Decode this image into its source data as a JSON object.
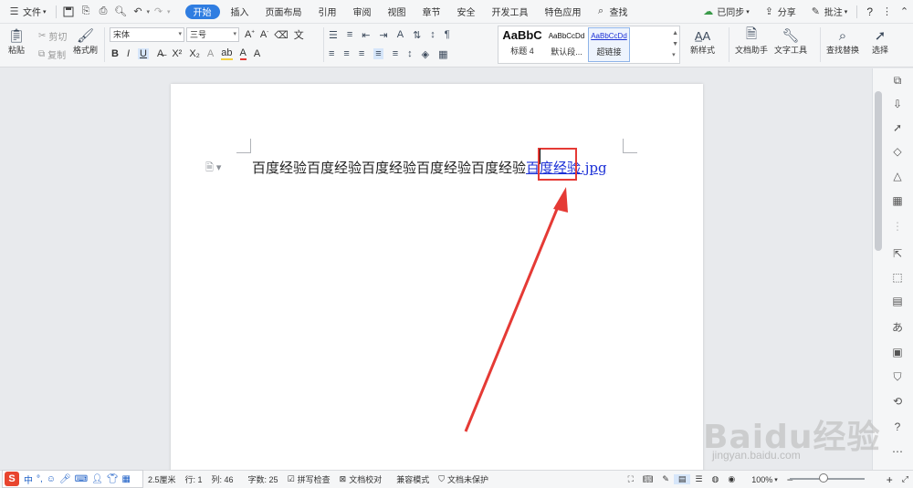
{
  "menubar": {
    "file_label": "文件",
    "tabs": [
      "开始",
      "插入",
      "页面布局",
      "引用",
      "审阅",
      "视图",
      "章节",
      "安全",
      "开发工具",
      "特色应用"
    ],
    "search_label": "查找",
    "sync_label": "已同步",
    "share_label": "分享",
    "comment_label": "批注",
    "help_label": "?"
  },
  "ribbon": {
    "paste_label": "粘贴",
    "cut_label": "剪切",
    "copy_label": "复制",
    "format_painter_label": "格式刷",
    "font_name": "宋体",
    "font_size": "三号",
    "styles": [
      {
        "sample": "AaBbC",
        "name": "标题 4"
      },
      {
        "sample": "AaBbCcDd",
        "name": "默认段..."
      },
      {
        "sample": "AaBbCcDd",
        "name": "超链接"
      }
    ],
    "new_style_label": "新样式",
    "doc_assistant_label": "文档助手",
    "text_tools_label": "文字工具",
    "find_replace_label": "查找替换",
    "select_label": "选择"
  },
  "document": {
    "text_plain": "百度经验百度经验百度经验百度经验百度经验",
    "text_link": "百度经验.jpg"
  },
  "statusbar": {
    "position_label": "2.5厘米",
    "row_label": "行: 1",
    "col_label": "列: 46",
    "word_count_label": "字数: 25",
    "spell_check_label": "拼写检查",
    "doc_proof_label": "文档校对",
    "compat_mode_label": "兼容模式",
    "unprotected_label": "文档未保护",
    "zoom_label": "100%",
    "zoom_level": 1.0
  },
  "ime": {
    "mode_label": "中"
  },
  "watermark": {
    "brand": "Baidu经验",
    "url": "jingyan.baidu.com"
  },
  "colors": {
    "accent": "#2f7de1",
    "highlight": "#e53a35",
    "link": "#1a2fd6"
  }
}
